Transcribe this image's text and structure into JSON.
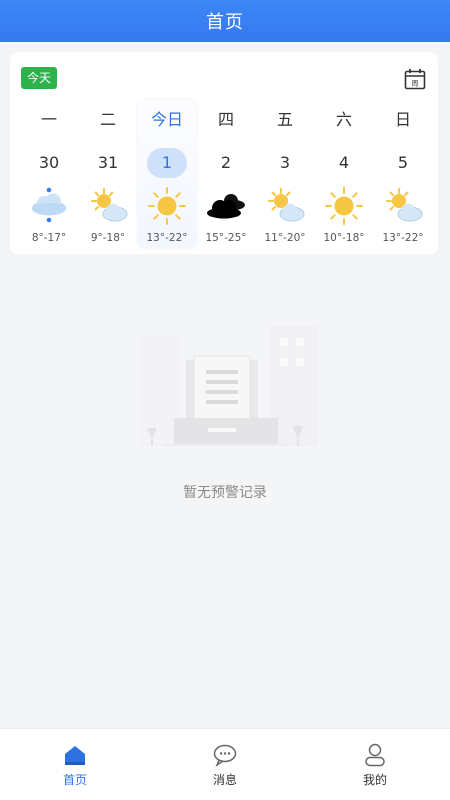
{
  "header": {
    "title": "首页"
  },
  "card": {
    "today_badge": "今天",
    "calendar_icon_label": "周",
    "days": [
      {
        "weekday": "一",
        "date": "30",
        "icon": "rain-cloud-icon",
        "temp": "8°-17°",
        "today": false
      },
      {
        "weekday": "二",
        "date": "31",
        "icon": "partly-cloudy-icon",
        "temp": "9°-18°",
        "today": false
      },
      {
        "weekday": "今日",
        "date": "1",
        "icon": "sun-icon",
        "temp": "13°-22°",
        "today": true
      },
      {
        "weekday": "四",
        "date": "2",
        "icon": "dark-cloud-icon",
        "temp": "15°-25°",
        "today": false
      },
      {
        "weekday": "五",
        "date": "3",
        "icon": "partly-cloudy-icon",
        "temp": "11°-20°",
        "today": false
      },
      {
        "weekday": "六",
        "date": "4",
        "icon": "sun-icon",
        "temp": "10°-18°",
        "today": false
      },
      {
        "weekday": "日",
        "date": "5",
        "icon": "partly-cloudy-icon",
        "temp": "13°-22°",
        "today": false
      }
    ]
  },
  "empty_state": {
    "text": "暂无预警记录"
  },
  "tabbar": {
    "tabs": [
      {
        "label": "首页",
        "icon": "home-icon",
        "active": true
      },
      {
        "label": "消息",
        "icon": "message-icon",
        "active": false
      },
      {
        "label": "我的",
        "icon": "user-icon",
        "active": false
      }
    ]
  },
  "colors": {
    "header": "#3579ee",
    "accent": "#2e72e0",
    "badge": "#2fb24b",
    "sun": "#f7c744",
    "cloud_light": "#cfe3f7"
  }
}
